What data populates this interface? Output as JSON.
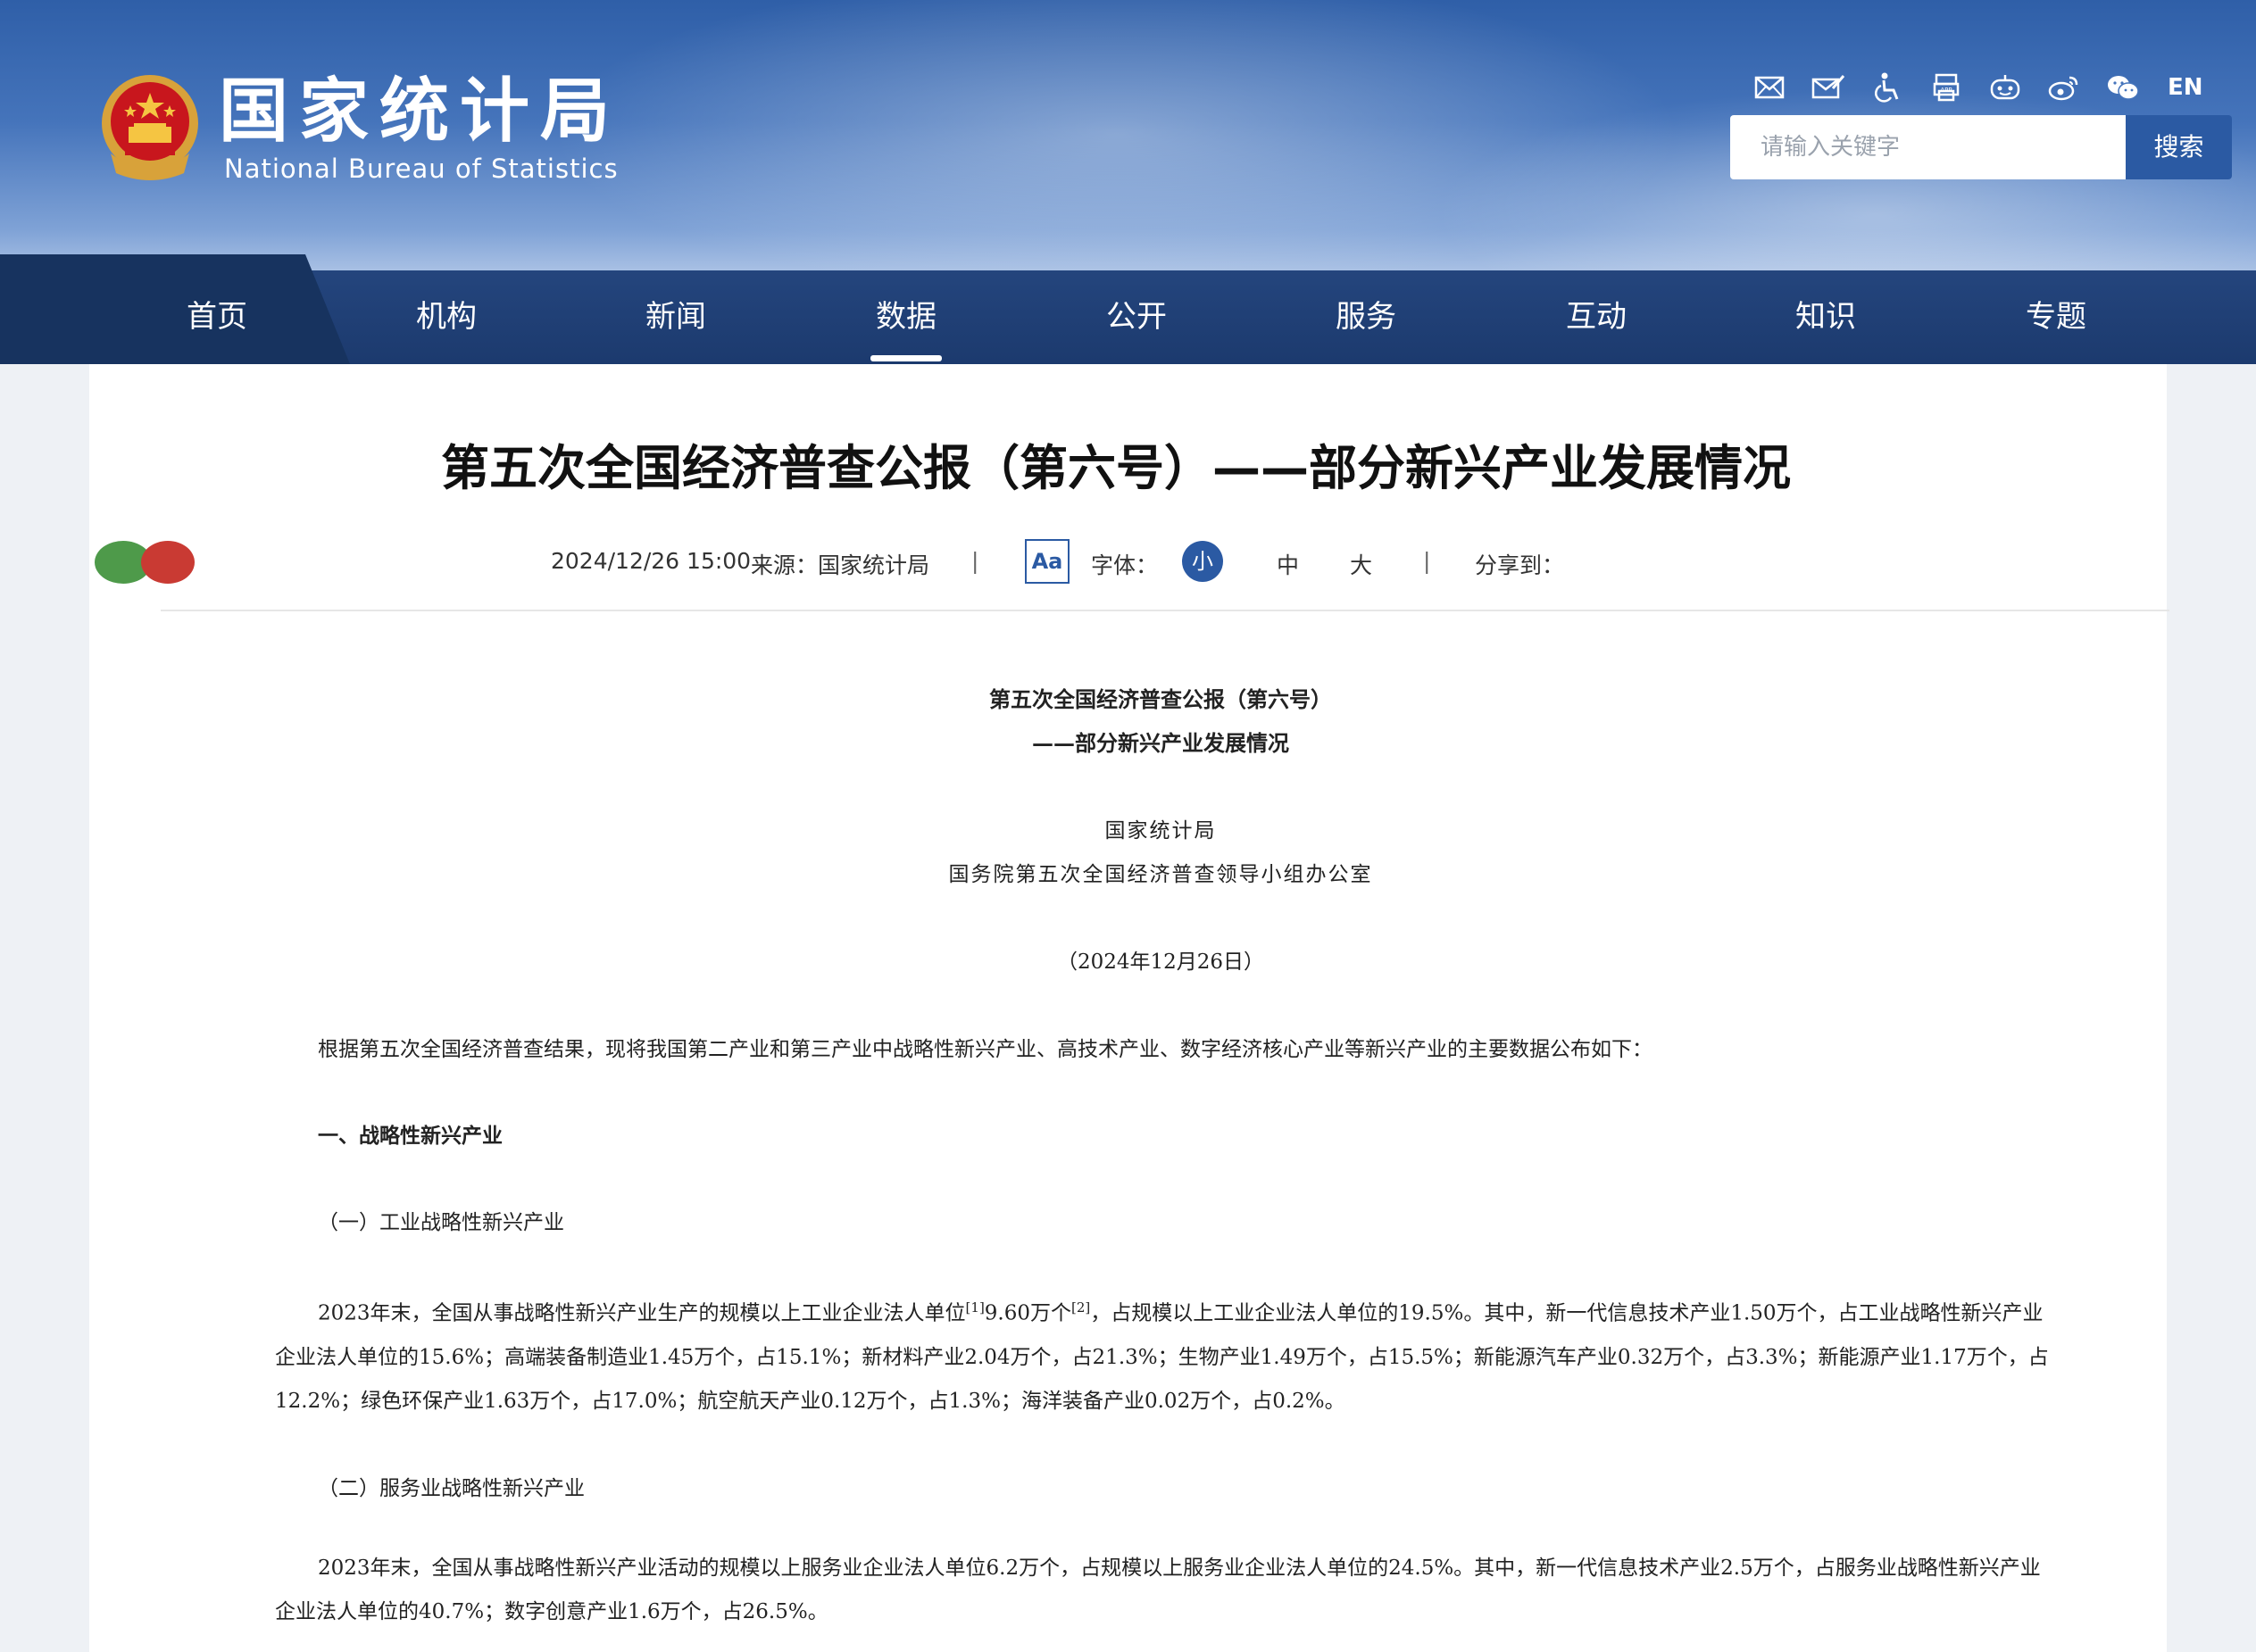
{
  "header": {
    "site_name_cn": "国家统计局",
    "site_name_en": "National Bureau of Statistics",
    "lang_toggle": "EN",
    "search": {
      "placeholder": "请输入关键字",
      "button_label": "搜索"
    },
    "tool_icons": [
      "mail-icon",
      "mail-edit-icon",
      "accessibility-icon",
      "app-icon",
      "robot-icon",
      "weibo-icon",
      "wechat-icon"
    ]
  },
  "nav": {
    "items": [
      "首页",
      "机构",
      "新闻",
      "数据",
      "公开",
      "服务",
      "互动",
      "知识",
      "专题"
    ],
    "active": "数据"
  },
  "article": {
    "title": "第五次全国经济普查公报（第六号）——部分新兴产业发展情况",
    "datetime": "2024/12/26 15:00",
    "source": "来源：国家统计局",
    "font_label": "字体：",
    "font_icon_label": "Aa",
    "font_sizes": [
      "小",
      "中",
      "大"
    ],
    "share_label": "分享到：",
    "separator": "|",
    "doc_title": "第五次全国经济普查公报（第六号）",
    "doc_subtitle": "——部分新兴产业发展情况",
    "issuer1": "国家统计局",
    "issuer2": "国务院第五次全国经济普查领导小组办公室",
    "doc_date": "（2024年12月26日）",
    "intro": "根据第五次全国经济普查结果，现将我国第二产业和第三产业中战略性新兴产业、高技术产业、数字经济核心产业等新兴产业的主要数据公布如下：",
    "section1": "一、战略性新兴产业",
    "sub1": "（一）工业战略性新兴产业",
    "para1_a": "2023年末，全国从事战略性新兴产业生产的规模以上工业企业法人单位",
    "para1_sup1": "[1]",
    "para1_b": "9.60万个",
    "para1_sup2": "[2]",
    "para1_c": "，占规模以上工业企业法人单位的19.5%。其中，新一代信息技术产业1.50万个，占工业战略性新兴产业企业法人单位的15.6%；高端装备制造业1.45万个，占15.1%；新材料产业2.04万个，占21.3%；生物产业1.49万个，占15.5%；新能源汽车产业0.32万个，占3.3%；新能源产业1.17万个，占12.2%；绿色环保产业1.63万个，占17.0%；航空航天产业0.12万个，占1.3%；海洋装备产业0.02万个，占0.2%。",
    "sub2": "（二）服务业战略性新兴产业",
    "para2": "2023年末，全国从事战略性新兴产业活动的规模以上服务业企业法人单位6.2万个，占规模以上服务业企业法人单位的24.5%。其中，新一代信息技术产业2.5万个，占服务业战略性新兴产业企业法人单位的40.7%；数字创意产业1.6万个，占26.5%。"
  }
}
